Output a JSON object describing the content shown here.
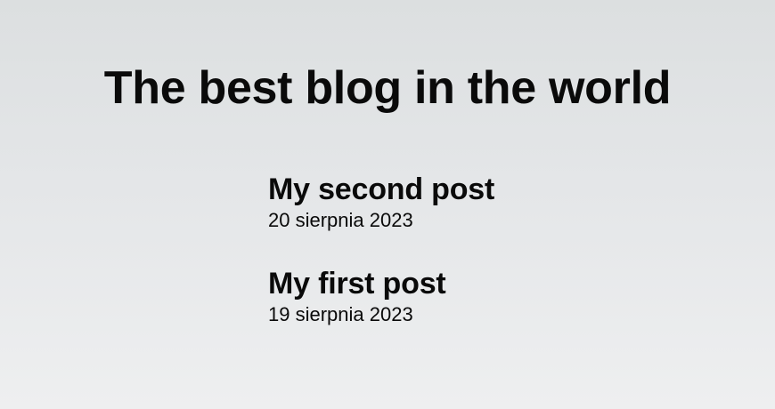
{
  "header": {
    "title": "The best blog in the world"
  },
  "posts": [
    {
      "title": "My second post",
      "date": "20 sierpnia 2023"
    },
    {
      "title": "My first post",
      "date": "19 sierpnia 2023"
    }
  ]
}
